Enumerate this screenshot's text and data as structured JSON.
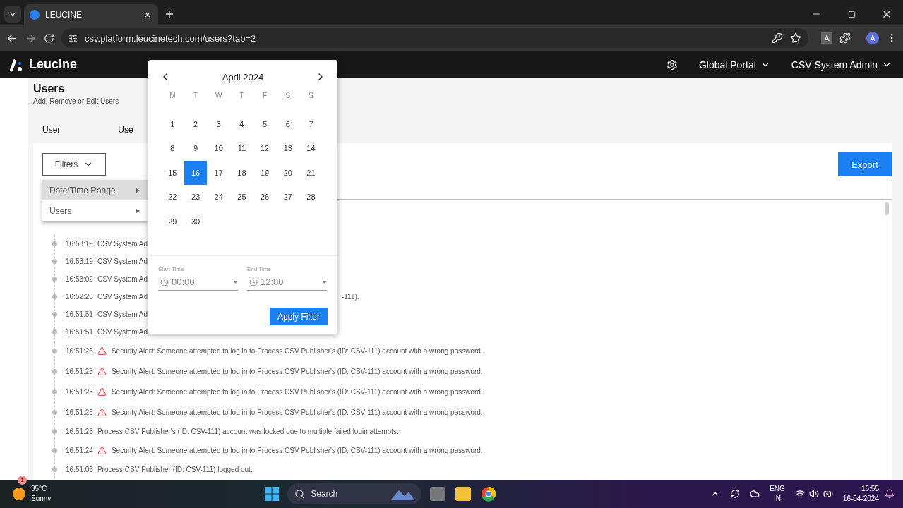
{
  "browser": {
    "tab_title": "LEUCINE",
    "url": "csv.platform.leucinetech.com/users?tab=2",
    "profile": "A",
    "extension": "A"
  },
  "app": {
    "brand": "Leucine",
    "nav": [
      {
        "label": "Global Portal"
      },
      {
        "label": "CSV System Admin"
      }
    ]
  },
  "page": {
    "title": "Users",
    "subtitle": "Add, Remove or Edit Users",
    "tabs": [
      "User",
      "Use"
    ]
  },
  "toolbar": {
    "filters": "Filters",
    "export": "Export"
  },
  "filter_menu": [
    {
      "label": "Date/Time Range",
      "selected": true
    },
    {
      "label": "Users",
      "selected": false
    }
  ],
  "calendar": {
    "month": "April 2024",
    "weekdays": [
      "M",
      "T",
      "W",
      "T",
      "F",
      "S",
      "S"
    ],
    "days": [
      {
        "label": "1",
        "selected": false
      },
      {
        "label": "2",
        "selected": false
      },
      {
        "label": "3",
        "selected": false
      },
      {
        "label": "4",
        "selected": false
      },
      {
        "label": "5",
        "selected": false
      },
      {
        "label": "6",
        "selected": false
      },
      {
        "label": "7",
        "selected": false
      },
      {
        "label": "8",
        "selected": false
      },
      {
        "label": "9",
        "selected": false
      },
      {
        "label": "10",
        "selected": false
      },
      {
        "label": "11",
        "selected": false
      },
      {
        "label": "12",
        "selected": false
      },
      {
        "label": "13",
        "selected": false
      },
      {
        "label": "14",
        "selected": false
      },
      {
        "label": "15",
        "selected": false
      },
      {
        "label": "16",
        "selected": true
      },
      {
        "label": "17",
        "selected": false
      },
      {
        "label": "18",
        "selected": false
      },
      {
        "label": "19",
        "selected": false
      },
      {
        "label": "20",
        "selected": false
      },
      {
        "label": "21",
        "selected": false
      },
      {
        "label": "22",
        "selected": false
      },
      {
        "label": "23",
        "selected": false
      },
      {
        "label": "24",
        "selected": false
      },
      {
        "label": "25",
        "selected": false
      },
      {
        "label": "26",
        "selected": false
      },
      {
        "label": "27",
        "selected": false
      },
      {
        "label": "28",
        "selected": false
      },
      {
        "label": "29",
        "selected": false
      },
      {
        "label": "30",
        "selected": false
      }
    ],
    "start_time": {
      "label": "Start Time",
      "value": "00:00"
    },
    "end_time": {
      "label": "End Time",
      "value": "12:00"
    },
    "apply": "Apply Filter"
  },
  "log": [
    {
      "time": "16:53:19",
      "message": "CSV System Ad",
      "kind": "info"
    },
    {
      "time": "16:53:19",
      "message": "CSV System Ad",
      "kind": "info"
    },
    {
      "time": "16:53:02",
      "message": "CSV System Ad",
      "kind": "info"
    },
    {
      "time": "16:52:25",
      "message": "CSV System Ad",
      "kind": "info",
      "tail": "-111)."
    },
    {
      "time": "16:51:51",
      "message": "CSV System Ad",
      "kind": "info"
    },
    {
      "time": "16:51:51",
      "message": "CSV System Ad",
      "kind": "info"
    },
    {
      "time": "16:51:26",
      "message": "Security Alert: Someone attempted to log in to Process CSV Publisher's (ID: CSV-111) account with a wrong password.",
      "kind": "alert"
    },
    {
      "time": "16:51:25",
      "message": "Security Alert: Someone attempted to log in to Process CSV Publisher's (ID: CSV-111) account with a wrong password.",
      "kind": "alert"
    },
    {
      "time": "16:51:25",
      "message": "Security Alert: Someone attempted to log in to Process CSV Publisher's (ID: CSV-111) account with a wrong password.",
      "kind": "alert"
    },
    {
      "time": "16:51:25",
      "message": "Security Alert: Someone attempted to log in to Process CSV Publisher's (ID: CSV-111) account with a wrong password.",
      "kind": "alert"
    },
    {
      "time": "16:51:25",
      "message": "Process CSV Publisher's (ID: CSV-111) account was locked due to multiple failed login attempts.",
      "kind": "info"
    },
    {
      "time": "16:51:24",
      "message": "Security Alert: Someone attempted to log in to Process CSV Publisher's (ID: CSV-111) account with a wrong password.",
      "kind": "alert"
    },
    {
      "time": "16:51:06",
      "message": "Process CSV Publisher (ID: CSV-111) logged out.",
      "kind": "info"
    }
  ],
  "taskbar": {
    "temperature": "35°C",
    "weather": "Sunny",
    "badge": "1",
    "search": "Search",
    "lang": "ENG",
    "region": "IN",
    "time": "16:55",
    "date": "16-04-2024"
  }
}
